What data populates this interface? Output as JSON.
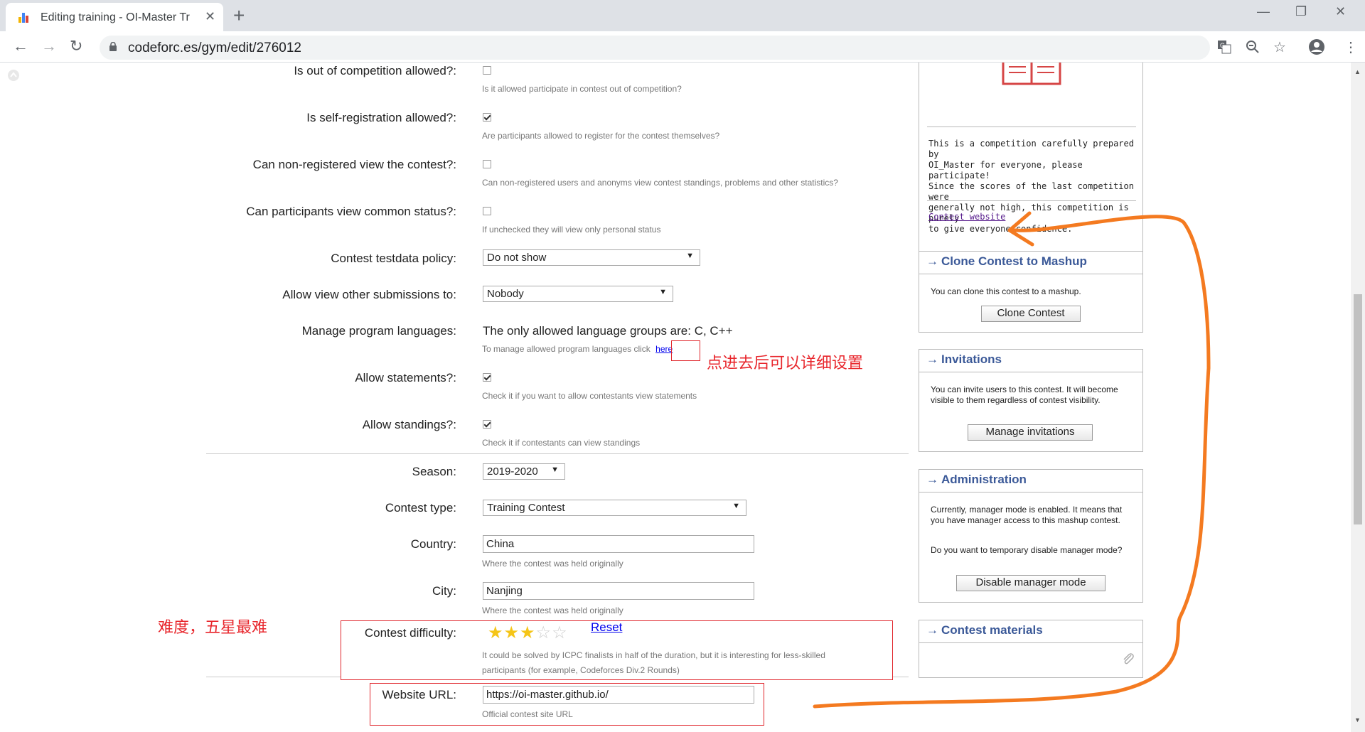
{
  "browser": {
    "tab_title": "Editing training - OI-Master Tr",
    "tab_close": "✕",
    "new_tab": "+",
    "url": "codeforc.es/gym/edit/276012",
    "window_controls": [
      "—",
      "❐",
      "✕"
    ]
  },
  "form": {
    "out_of_comp": {
      "label": "Is out of competition allowed?:",
      "checked": false,
      "hint": "Is it allowed participate in contest out of competition?"
    },
    "self_reg": {
      "label": "Is self-registration allowed?:",
      "checked": true,
      "hint": "Are participants allowed to register for the contest themselves?"
    },
    "non_reg_view": {
      "label": "Can non-registered view the contest?:",
      "checked": false,
      "hint": "Can non-registered users and anonyms view contest standings, problems and other statistics?"
    },
    "common_status": {
      "label": "Can participants view common status?:",
      "checked": false,
      "hint": "If unchecked they will view only personal status"
    },
    "testdata_policy": {
      "label": "Contest testdata policy:",
      "value": "Do not show"
    },
    "other_submissions": {
      "label": "Allow view other submissions to:",
      "value": "Nobody"
    },
    "languages": {
      "label": "Manage program languages:",
      "text": "The only allowed language groups are: C, C++",
      "hint": "To manage allowed program languages click",
      "link": "here"
    },
    "statements": {
      "label": "Allow statements?:",
      "checked": true,
      "hint": "Check it if you want to allow contestants view statements"
    },
    "standings": {
      "label": "Allow standings?:",
      "checked": true,
      "hint": "Check it if contestants can view standings"
    },
    "season": {
      "label": "Season:",
      "value": "2019-2020"
    },
    "contest_type": {
      "label": "Contest type:",
      "value": "Training Contest"
    },
    "country": {
      "label": "Country:",
      "value": "China",
      "hint": "Where the contest was held originally"
    },
    "city": {
      "label": "City:",
      "value": "Nanjing",
      "hint": "Where the contest was held originally"
    },
    "difficulty": {
      "label": "Contest difficulty:",
      "stars": 3,
      "max_stars": 5,
      "reset": "Reset",
      "hint1": "It could be solved by ICPC finalists in half of the duration, but it is interesting for less-skilled",
      "hint2": "participants (for example, Codeforces Div.2 Rounds)"
    },
    "website": {
      "label": "Website URL:",
      "value": "https://oi-master.github.io/",
      "hint": "Official contest site URL"
    }
  },
  "sidebar": {
    "info": {
      "description_lines": [
        "This is a competition carefully prepared by",
        "OI_Master for everyone, please participate!",
        "Since the scores of the last competition were",
        "generally not high, this competition is purely",
        "to give everyone confidence."
      ],
      "link": "Contest website"
    },
    "clone": {
      "arrow": "→",
      "title": "Clone Contest to Mashup",
      "body": "You can clone this contest to a mashup.",
      "button": "Clone Contest"
    },
    "invitations": {
      "arrow": "→",
      "title": "Invitations",
      "body": "You can invite users to this contest. It will become visible to them regardless of contest visibility.",
      "button": "Manage invitations"
    },
    "admin": {
      "arrow": "→",
      "title": "Administration",
      "body1": "Currently, manager mode is enabled. It means that you have manager access to this mashup contest.",
      "body2": "Do you want to temporary disable manager mode?",
      "button": "Disable manager mode"
    },
    "materials": {
      "arrow": "→",
      "title": "Contest materials"
    }
  },
  "annotations": {
    "note_here": "点进去后可以详细设置",
    "note_difficulty": "难度，五星最难"
  },
  "colors": {
    "accent": "#3b5998",
    "annotation_red": "#e8262c",
    "annotation_orange": "#f47a20"
  }
}
